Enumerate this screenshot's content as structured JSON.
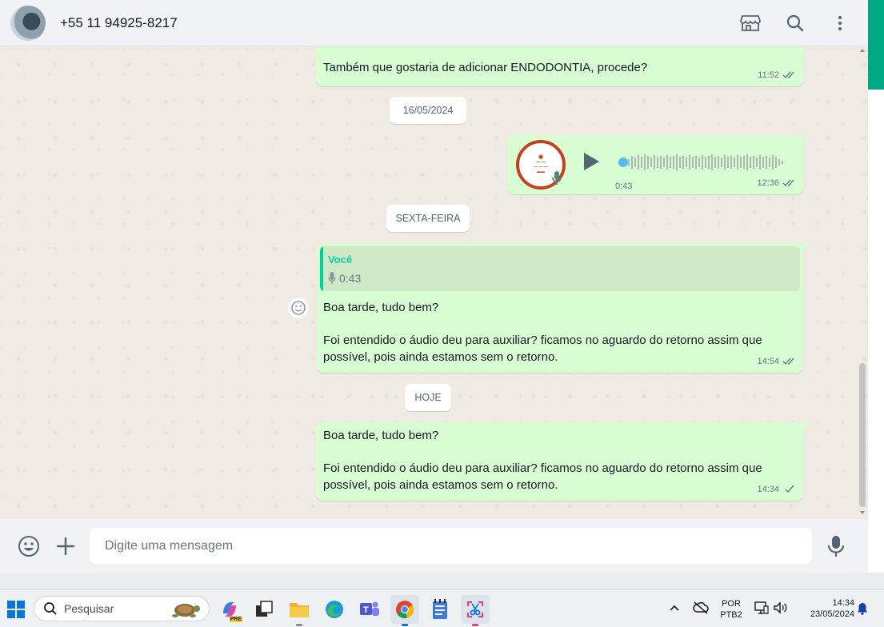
{
  "header": {
    "contact_name": "+55 11 94925-8217",
    "icons": [
      "store-icon",
      "search-icon",
      "more-vert-icon"
    ]
  },
  "chat": {
    "messages": [
      {
        "text": "Também que gostaria de adicionar ENDODONTIA, procede?",
        "time": "11:52",
        "status": "read"
      },
      {
        "date_chip": "16/05/2024"
      },
      {
        "type": "voice",
        "duration": "0:43",
        "time": "12:36",
        "status": "read"
      },
      {
        "date_chip": "SEXTA-FEIRA"
      },
      {
        "quote_author": "Você",
        "quote_body": "0:43",
        "text": "Boa tarde, tudo bem?\n\nFoi entendido o áudio deu para auxiliar? ficamos no aguardo do retorno assim que\npossível, pois ainda estamos sem o retorno.",
        "time": "14:54",
        "status": "read"
      },
      {
        "date_chip": "HOJE"
      },
      {
        "text": "Boa tarde, tudo bem?\n\nFoi entendido o áudio deu para auxiliar? ficamos no aguardo do retorno assim que\npossível, pois ainda estamos sem o retorno.",
        "time": "14:34",
        "status": "sent"
      }
    ]
  },
  "composer": {
    "placeholder": "Digite uma mensagem"
  },
  "taskbar": {
    "search_label": "Pesquisar",
    "lang_line1": "POR",
    "lang_line2": "PTB2",
    "time": "14:34",
    "date": "23/05/2024",
    "copilot_badge": "PRE"
  },
  "colors": {
    "outgoing_bubble": "#d9fdd3",
    "accent": "#00a884",
    "read_tick": "#667781",
    "quote_author": "#06cf9c"
  }
}
